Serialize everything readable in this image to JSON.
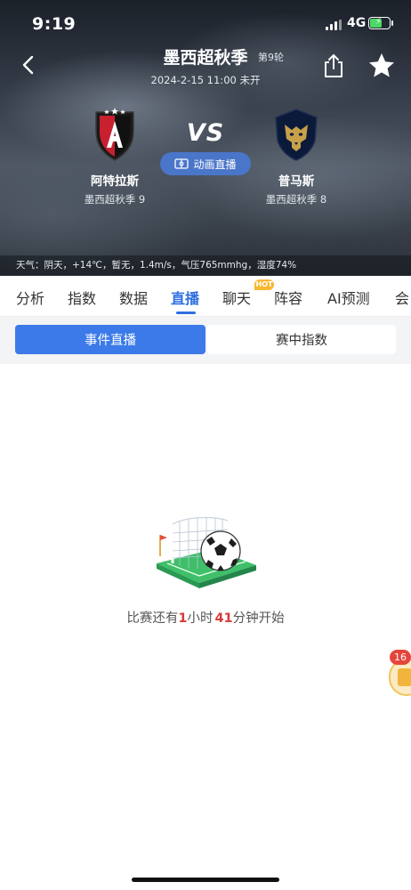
{
  "status_bar": {
    "time": "9:19",
    "network": "4G"
  },
  "header": {
    "title": "墨西超秋季",
    "round": "第9轮",
    "datetime_status": "2024-2-15 11:00 未开",
    "vs_label": "VS",
    "animation_button": "动画直播"
  },
  "home_team": {
    "name": "阿特拉斯",
    "league_rank": "墨西超秋季 9"
  },
  "away_team": {
    "name": "普马斯",
    "league_rank": "墨西超秋季 8"
  },
  "weather": "天气：阴天，+14℃，暂无，1.4m/s，气压765mmhg，湿度74%",
  "tabs": [
    {
      "label": "分析"
    },
    {
      "label": "指数"
    },
    {
      "label": "数据"
    },
    {
      "label": "直播",
      "active": true
    },
    {
      "label": "聊天",
      "badge": "HOT"
    },
    {
      "label": "阵容"
    },
    {
      "label": "AI预测"
    },
    {
      "label": "会"
    }
  ],
  "subtabs": {
    "active": "事件直播",
    "inactive": "赛中指数"
  },
  "countdown": {
    "prefix": "比赛还有",
    "hours": "1",
    "hours_unit": "小时",
    "minutes": "41",
    "minutes_unit": "分钟开始"
  },
  "floating": {
    "badge": "16"
  },
  "colors": {
    "accent": "#2f6fe0",
    "highlight": "#d93a3a",
    "header_dark": "#39414d"
  }
}
